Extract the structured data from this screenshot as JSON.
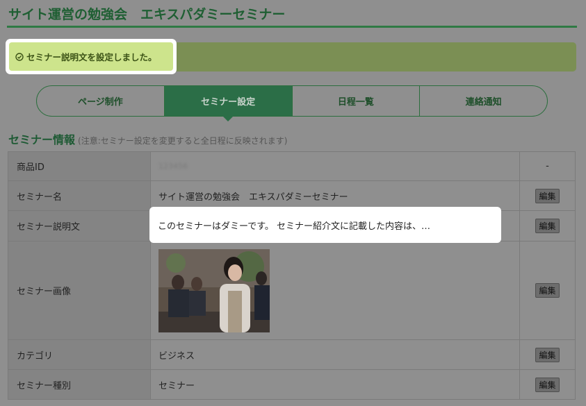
{
  "header": {
    "title": "サイト運営の勉強会　エキスパダミーセミナー"
  },
  "alert": {
    "icon": "check-circle-icon",
    "message": "セミナー説明文を設定しました。"
  },
  "tabs": [
    {
      "label": "ページ制作",
      "active": false
    },
    {
      "label": "セミナー設定",
      "active": true
    },
    {
      "label": "日程一覧",
      "active": false
    },
    {
      "label": "連絡通知",
      "active": false
    }
  ],
  "section": {
    "title": "セミナー情報",
    "note": "(注意:セミナー設定を変更すると全日程に反映されます)"
  },
  "table": {
    "rows": [
      {
        "label": "商品ID",
        "value": "123456",
        "action": "-"
      },
      {
        "label": "セミナー名",
        "value": "サイト運営の勉強会　エキスパダミーセミナー",
        "action": "編集"
      },
      {
        "label": "セミナー説明文",
        "value": "このセミナーはダミーです。 セミナー紹介文に記載した内容は、…",
        "action": "編集"
      },
      {
        "label": "セミナー画像",
        "value": "",
        "action": "編集"
      },
      {
        "label": "カテゴリ",
        "value": "ビジネス",
        "action": "編集"
      },
      {
        "label": "セミナー種別",
        "value": "セミナー",
        "action": "編集"
      }
    ]
  },
  "colors": {
    "brand_green": "#2b6e47",
    "alert_highlight": "#cde48c",
    "overlay_gray": "#8f8f8f"
  }
}
